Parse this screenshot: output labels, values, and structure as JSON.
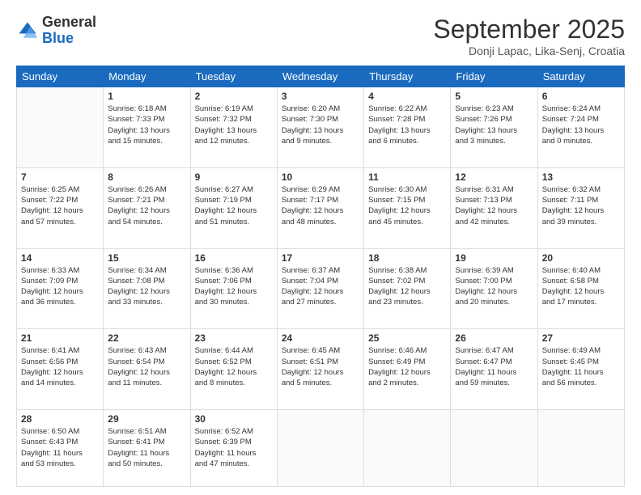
{
  "header": {
    "logo_general": "General",
    "logo_blue": "Blue",
    "month_title": "September 2025",
    "subtitle": "Donji Lapac, Lika-Senj, Croatia"
  },
  "days_of_week": [
    "Sunday",
    "Monday",
    "Tuesday",
    "Wednesday",
    "Thursday",
    "Friday",
    "Saturday"
  ],
  "weeks": [
    [
      {
        "day": "",
        "info": ""
      },
      {
        "day": "1",
        "info": "Sunrise: 6:18 AM\nSunset: 7:33 PM\nDaylight: 13 hours\nand 15 minutes."
      },
      {
        "day": "2",
        "info": "Sunrise: 6:19 AM\nSunset: 7:32 PM\nDaylight: 13 hours\nand 12 minutes."
      },
      {
        "day": "3",
        "info": "Sunrise: 6:20 AM\nSunset: 7:30 PM\nDaylight: 13 hours\nand 9 minutes."
      },
      {
        "day": "4",
        "info": "Sunrise: 6:22 AM\nSunset: 7:28 PM\nDaylight: 13 hours\nand 6 minutes."
      },
      {
        "day": "5",
        "info": "Sunrise: 6:23 AM\nSunset: 7:26 PM\nDaylight: 13 hours\nand 3 minutes."
      },
      {
        "day": "6",
        "info": "Sunrise: 6:24 AM\nSunset: 7:24 PM\nDaylight: 13 hours\nand 0 minutes."
      }
    ],
    [
      {
        "day": "7",
        "info": "Sunrise: 6:25 AM\nSunset: 7:22 PM\nDaylight: 12 hours\nand 57 minutes."
      },
      {
        "day": "8",
        "info": "Sunrise: 6:26 AM\nSunset: 7:21 PM\nDaylight: 12 hours\nand 54 minutes."
      },
      {
        "day": "9",
        "info": "Sunrise: 6:27 AM\nSunset: 7:19 PM\nDaylight: 12 hours\nand 51 minutes."
      },
      {
        "day": "10",
        "info": "Sunrise: 6:29 AM\nSunset: 7:17 PM\nDaylight: 12 hours\nand 48 minutes."
      },
      {
        "day": "11",
        "info": "Sunrise: 6:30 AM\nSunset: 7:15 PM\nDaylight: 12 hours\nand 45 minutes."
      },
      {
        "day": "12",
        "info": "Sunrise: 6:31 AM\nSunset: 7:13 PM\nDaylight: 12 hours\nand 42 minutes."
      },
      {
        "day": "13",
        "info": "Sunrise: 6:32 AM\nSunset: 7:11 PM\nDaylight: 12 hours\nand 39 minutes."
      }
    ],
    [
      {
        "day": "14",
        "info": "Sunrise: 6:33 AM\nSunset: 7:09 PM\nDaylight: 12 hours\nand 36 minutes."
      },
      {
        "day": "15",
        "info": "Sunrise: 6:34 AM\nSunset: 7:08 PM\nDaylight: 12 hours\nand 33 minutes."
      },
      {
        "day": "16",
        "info": "Sunrise: 6:36 AM\nSunset: 7:06 PM\nDaylight: 12 hours\nand 30 minutes."
      },
      {
        "day": "17",
        "info": "Sunrise: 6:37 AM\nSunset: 7:04 PM\nDaylight: 12 hours\nand 27 minutes."
      },
      {
        "day": "18",
        "info": "Sunrise: 6:38 AM\nSunset: 7:02 PM\nDaylight: 12 hours\nand 23 minutes."
      },
      {
        "day": "19",
        "info": "Sunrise: 6:39 AM\nSunset: 7:00 PM\nDaylight: 12 hours\nand 20 minutes."
      },
      {
        "day": "20",
        "info": "Sunrise: 6:40 AM\nSunset: 6:58 PM\nDaylight: 12 hours\nand 17 minutes."
      }
    ],
    [
      {
        "day": "21",
        "info": "Sunrise: 6:41 AM\nSunset: 6:56 PM\nDaylight: 12 hours\nand 14 minutes."
      },
      {
        "day": "22",
        "info": "Sunrise: 6:43 AM\nSunset: 6:54 PM\nDaylight: 12 hours\nand 11 minutes."
      },
      {
        "day": "23",
        "info": "Sunrise: 6:44 AM\nSunset: 6:52 PM\nDaylight: 12 hours\nand 8 minutes."
      },
      {
        "day": "24",
        "info": "Sunrise: 6:45 AM\nSunset: 6:51 PM\nDaylight: 12 hours\nand 5 minutes."
      },
      {
        "day": "25",
        "info": "Sunrise: 6:46 AM\nSunset: 6:49 PM\nDaylight: 12 hours\nand 2 minutes."
      },
      {
        "day": "26",
        "info": "Sunrise: 6:47 AM\nSunset: 6:47 PM\nDaylight: 11 hours\nand 59 minutes."
      },
      {
        "day": "27",
        "info": "Sunrise: 6:49 AM\nSunset: 6:45 PM\nDaylight: 11 hours\nand 56 minutes."
      }
    ],
    [
      {
        "day": "28",
        "info": "Sunrise: 6:50 AM\nSunset: 6:43 PM\nDaylight: 11 hours\nand 53 minutes."
      },
      {
        "day": "29",
        "info": "Sunrise: 6:51 AM\nSunset: 6:41 PM\nDaylight: 11 hours\nand 50 minutes."
      },
      {
        "day": "30",
        "info": "Sunrise: 6:52 AM\nSunset: 6:39 PM\nDaylight: 11 hours\nand 47 minutes."
      },
      {
        "day": "",
        "info": ""
      },
      {
        "day": "",
        "info": ""
      },
      {
        "day": "",
        "info": ""
      },
      {
        "day": "",
        "info": ""
      }
    ]
  ]
}
